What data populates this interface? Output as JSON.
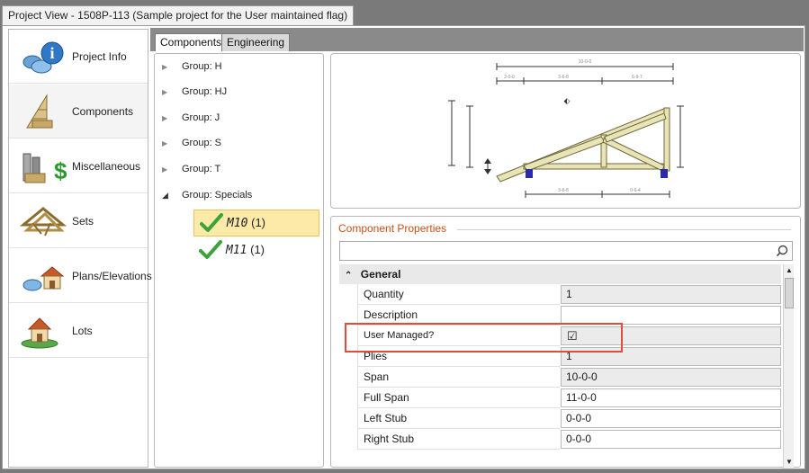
{
  "window": {
    "title": "Project View - 1508P-113 (Sample project for the User maintained flag)"
  },
  "nav": {
    "items": [
      {
        "label": "Project Info",
        "icon": "info-globe-icon"
      },
      {
        "label": "Components",
        "icon": "truss-component-icon"
      },
      {
        "label": "Miscellaneous",
        "icon": "hardware-dollar-icon"
      },
      {
        "label": "Sets",
        "icon": "truss-set-icon"
      },
      {
        "label": "Plans/Elevations",
        "icon": "house-plan-icon"
      },
      {
        "label": "Lots",
        "icon": "house-lot-icon"
      }
    ],
    "selected": "Components"
  },
  "tabs": [
    {
      "label": "Components"
    },
    {
      "label": "Engineering"
    }
  ],
  "tree": {
    "groups": [
      {
        "label": "Group:  H",
        "expanded": false
      },
      {
        "label": "Group:  HJ",
        "expanded": false
      },
      {
        "label": "Group:  J",
        "expanded": false
      },
      {
        "label": "Group:  S",
        "expanded": false
      },
      {
        "label": "Group:  T",
        "expanded": false
      },
      {
        "label": "Group:  Specials",
        "expanded": true
      }
    ],
    "leaves": [
      {
        "name": "M10",
        "count": "(1)",
        "selected": true
      },
      {
        "name": "M11",
        "count": "(1)",
        "selected": false
      }
    ]
  },
  "drawing": {
    "dims": [
      "10-0-0",
      "2-0-0",
      "3-6-8",
      "6-9-7",
      "0-6-4"
    ]
  },
  "properties": {
    "title": "Component Properties",
    "category": "General",
    "rows": [
      {
        "name": "Quantity",
        "value": "1",
        "readonly": true
      },
      {
        "name": "Description",
        "value": "",
        "readonly": false
      },
      {
        "name": "User Managed?",
        "value": "☑",
        "readonly": true
      },
      {
        "name": "Plies",
        "value": "1",
        "readonly": true
      },
      {
        "name": "Span",
        "value": "10-0-0",
        "readonly": true
      },
      {
        "name": "Full Span",
        "value": "11-0-0",
        "readonly": false
      },
      {
        "name": "Left Stub",
        "value": "0-0-0",
        "readonly": false
      },
      {
        "name": "Right Stub",
        "value": "0-0-0",
        "readonly": false
      }
    ]
  },
  "colors": {
    "accent": "#c8501a",
    "highlight": "#e04b3c",
    "selected_leaf": "#fde9a8",
    "check": "#3aa33a"
  }
}
